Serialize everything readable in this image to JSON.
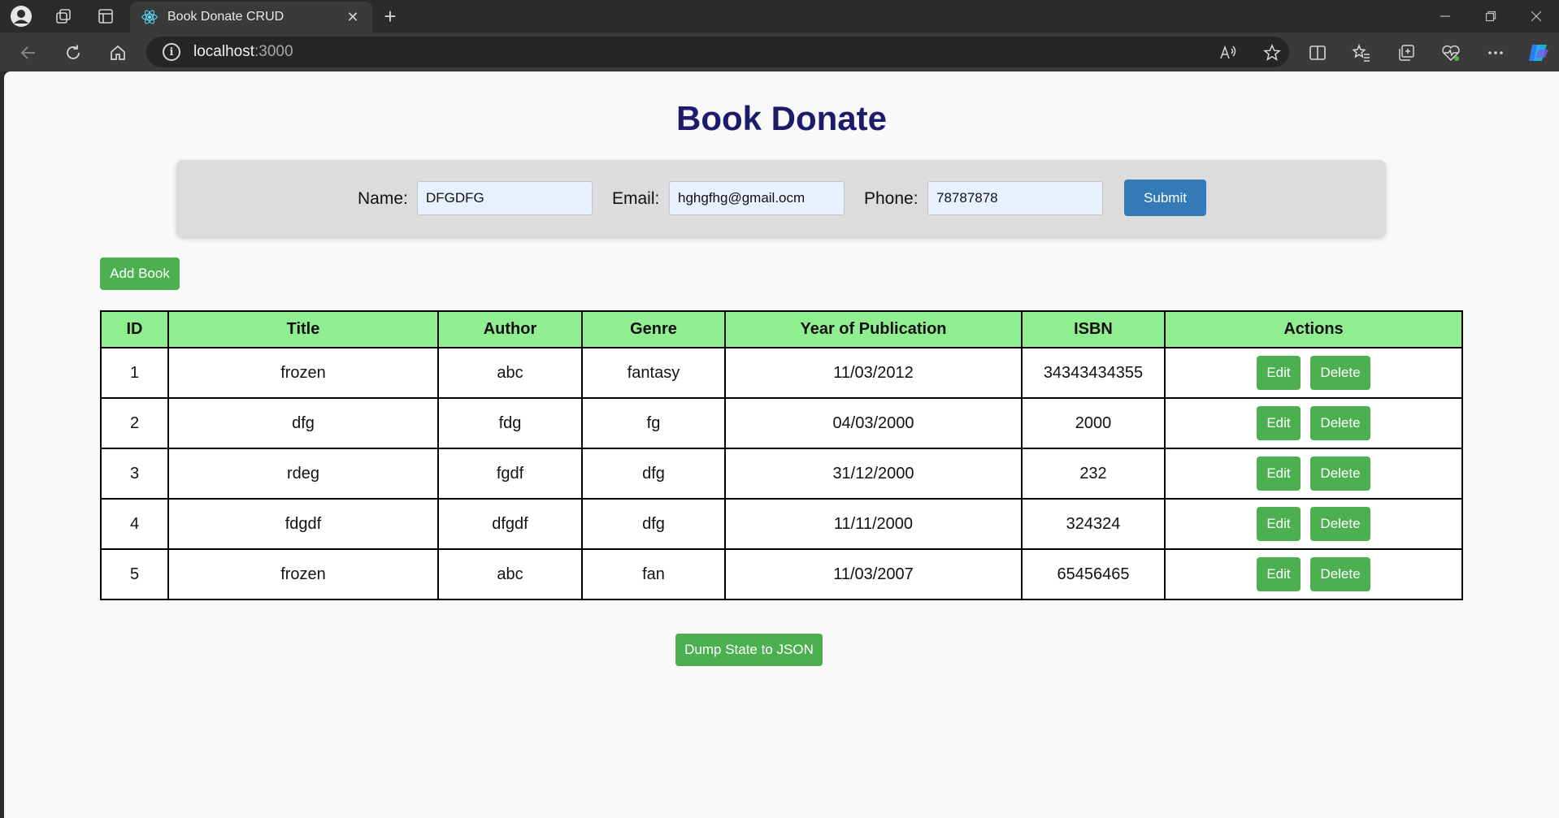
{
  "browser": {
    "tab_title": "Book Donate CRUD",
    "address_host": "localhost",
    "address_port": ":3000"
  },
  "page": {
    "title": "Book Donate"
  },
  "form": {
    "name_label": "Name:",
    "name_value": "DFGDFG",
    "email_label": "Email:",
    "email_value": "hghgfhg@gmail.ocm",
    "phone_label": "Phone:",
    "phone_value": "78787878",
    "submit_label": "Submit"
  },
  "actions": {
    "add_book_label": "Add Book",
    "dump_label": "Dump State to JSON"
  },
  "table": {
    "headers": [
      "ID",
      "Title",
      "Author",
      "Genre",
      "Year of Publication",
      "ISBN",
      "Actions"
    ],
    "edit_label": "Edit",
    "delete_label": "Delete",
    "rows": [
      {
        "id": "1",
        "title": "frozen",
        "author": "abc",
        "genre": "fantasy",
        "year": "11/03/2012",
        "isbn": "34343434355"
      },
      {
        "id": "2",
        "title": "dfg",
        "author": "fdg",
        "genre": "fg",
        "year": "04/03/2000",
        "isbn": "2000"
      },
      {
        "id": "3",
        "title": "rdeg",
        "author": "fgdf",
        "genre": "dfg",
        "year": "31/12/2000",
        "isbn": "232"
      },
      {
        "id": "4",
        "title": "fdgdf",
        "author": "dfgdf",
        "genre": "dfg",
        "year": "11/11/2000",
        "isbn": "324324"
      },
      {
        "id": "5",
        "title": "frozen",
        "author": "abc",
        "genre": "fan",
        "year": "11/03/2007",
        "isbn": "65456465"
      }
    ]
  },
  "colors": {
    "title": "#1c1c6b",
    "header_bg": "#90ee90",
    "green_button": "#4caf50",
    "submit_button": "#337ab7",
    "input_bg": "#e8f0fe"
  },
  "icons": [
    "profile-icon",
    "workspaces-icon",
    "tab-actions-icon",
    "react-favicon-icon",
    "close-icon",
    "new-tab-icon",
    "minimize-icon",
    "restore-icon",
    "window-close-icon",
    "back-icon",
    "refresh-icon",
    "home-icon",
    "site-info-icon",
    "read-aloud-icon",
    "favorite-icon",
    "split-screen-icon",
    "favorites-icon",
    "collections-icon",
    "browser-essentials-icon",
    "more-icon",
    "copilot-icon"
  ]
}
